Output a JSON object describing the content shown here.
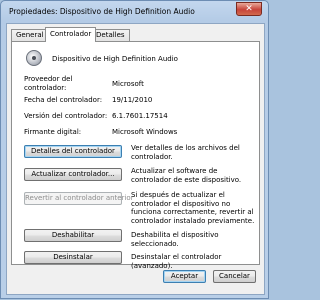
{
  "window": {
    "title": "Propiedades: Dispositivo de High Definition Audio",
    "close_label": "✕"
  },
  "tabs": [
    {
      "label": "General"
    },
    {
      "label": "Controlador"
    },
    {
      "label": "Detalles"
    }
  ],
  "device": {
    "name": "Dispositivo de High Definition Audio",
    "icon": "speaker-icon"
  },
  "properties": {
    "provider_label": "Proveedor del controlador:",
    "provider_value": "Microsoft",
    "date_label": "Fecha del controlador:",
    "date_value": "19/11/2010",
    "version_label": "Versión del controlador:",
    "version_value": "6.1.7601.17514",
    "signer_label": "Firmante digital:",
    "signer_value": "Microsoft Windows"
  },
  "actions": {
    "details_label": "Detalles del controlador",
    "details_desc": "Ver detalles de los archivos del controlador.",
    "update_label": "Actualizar controlador...",
    "update_desc": "Actualizar el software de controlador de este dispositivo.",
    "rollback_label": "Revertir al controlador anterior",
    "rollback_desc": "Si después de actualizar el controlador el dispositivo no funciona correctamente, revertir al controlador instalado previamente.",
    "disable_label": "Deshabilitar",
    "disable_desc": "Deshabilita el dispositivo seleccionado.",
    "uninstall_label": "Desinstalar",
    "uninstall_desc": "Desinstalar el controlador (avanzado)."
  },
  "footer": {
    "ok_label": "Aceptar",
    "cancel_label": "Cancelar"
  }
}
